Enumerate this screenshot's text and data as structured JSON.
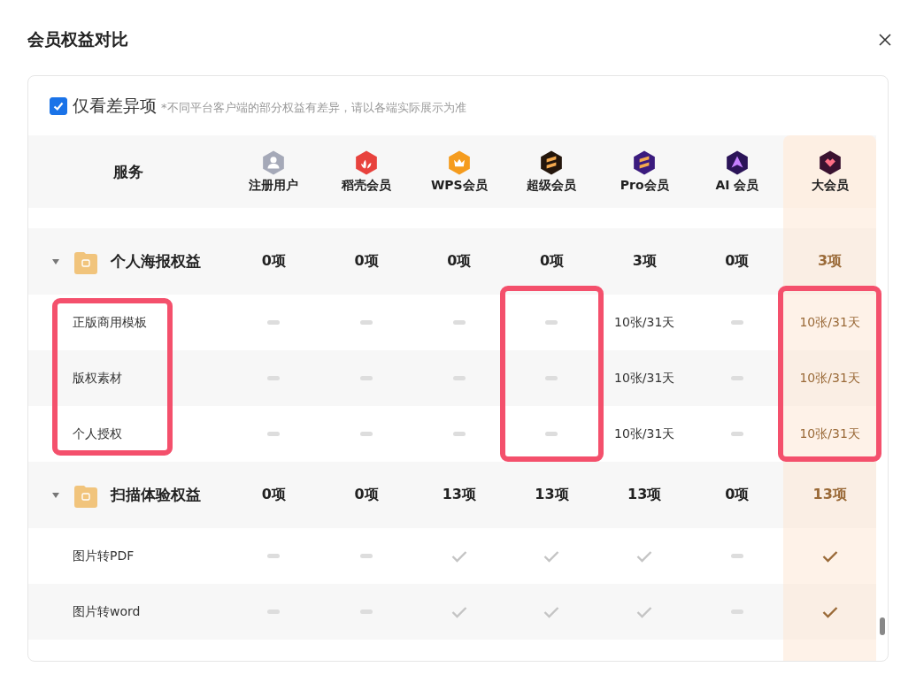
{
  "dialog": {
    "title": "会员权益对比"
  },
  "filter": {
    "label": "仅看差异项",
    "checked": true,
    "note": "*不同平台客户端的部分权益有差异，请以各端实际展示为准"
  },
  "columns": [
    {
      "label": "服务",
      "kind": "service",
      "highlighted": true
    },
    {
      "label": "注册用户",
      "kind": "plan",
      "color": "#a5a9b8",
      "featured": false,
      "highlighted": false
    },
    {
      "label": "稻壳会员",
      "kind": "plan",
      "color": "#e8423d",
      "featured": false,
      "highlighted": false
    },
    {
      "label": "WPS会员",
      "kind": "plan",
      "color": "#f59c1e",
      "featured": false,
      "highlighted": false
    },
    {
      "label": "超级会员",
      "kind": "plan",
      "color": "#24160c",
      "featured": false,
      "highlighted": true
    },
    {
      "label": "Pro会员",
      "kind": "plan",
      "color": "#3b1b7e",
      "featured": false,
      "highlighted": false
    },
    {
      "label": "AI 会员",
      "kind": "plan",
      "color": "#2b1458",
      "featured": false,
      "highlighted": false
    },
    {
      "label": "大会员",
      "kind": "plan",
      "color": "#3a1230",
      "featured": true,
      "highlighted": true
    }
  ],
  "groups": [
    {
      "name": "个人海报权益",
      "expanded": true,
      "highlighted": true,
      "counts": [
        "0项",
        "0项",
        "0项",
        "0项",
        "3项",
        "0项",
        "3项"
      ],
      "items": [
        {
          "name": "正版商用模板",
          "cells": [
            {
              "kind": "dash"
            },
            {
              "kind": "dash"
            },
            {
              "kind": "dash"
            },
            {
              "kind": "dash"
            },
            {
              "kind": "text",
              "text": "10张/31天"
            },
            {
              "kind": "dash"
            },
            {
              "kind": "text",
              "text": "10张/31天"
            }
          ]
        },
        {
          "name": "版权素材",
          "cells": [
            {
              "kind": "dash"
            },
            {
              "kind": "dash"
            },
            {
              "kind": "dash"
            },
            {
              "kind": "dash"
            },
            {
              "kind": "text",
              "text": "10张/31天"
            },
            {
              "kind": "dash"
            },
            {
              "kind": "text",
              "text": "10张/31天"
            }
          ]
        },
        {
          "name": "个人授权",
          "cells": [
            {
              "kind": "dash"
            },
            {
              "kind": "dash"
            },
            {
              "kind": "dash"
            },
            {
              "kind": "dash"
            },
            {
              "kind": "text",
              "text": "10张/31天"
            },
            {
              "kind": "dash"
            },
            {
              "kind": "text",
              "text": "10张/31天"
            }
          ]
        }
      ]
    },
    {
      "name": "扫描体验权益",
      "expanded": true,
      "highlighted": false,
      "counts": [
        "0项",
        "0项",
        "13项",
        "13项",
        "13项",
        "0项",
        "13项"
      ],
      "items": [
        {
          "name": "图片转PDF",
          "cells": [
            {
              "kind": "dash"
            },
            {
              "kind": "dash"
            },
            {
              "kind": "check"
            },
            {
              "kind": "check"
            },
            {
              "kind": "check"
            },
            {
              "kind": "dash"
            },
            {
              "kind": "check"
            }
          ]
        },
        {
          "name": "图片转word",
          "cells": [
            {
              "kind": "dash"
            },
            {
              "kind": "dash"
            },
            {
              "kind": "check"
            },
            {
              "kind": "check"
            },
            {
              "kind": "check"
            },
            {
              "kind": "dash"
            },
            {
              "kind": "check"
            }
          ]
        }
      ]
    }
  ]
}
